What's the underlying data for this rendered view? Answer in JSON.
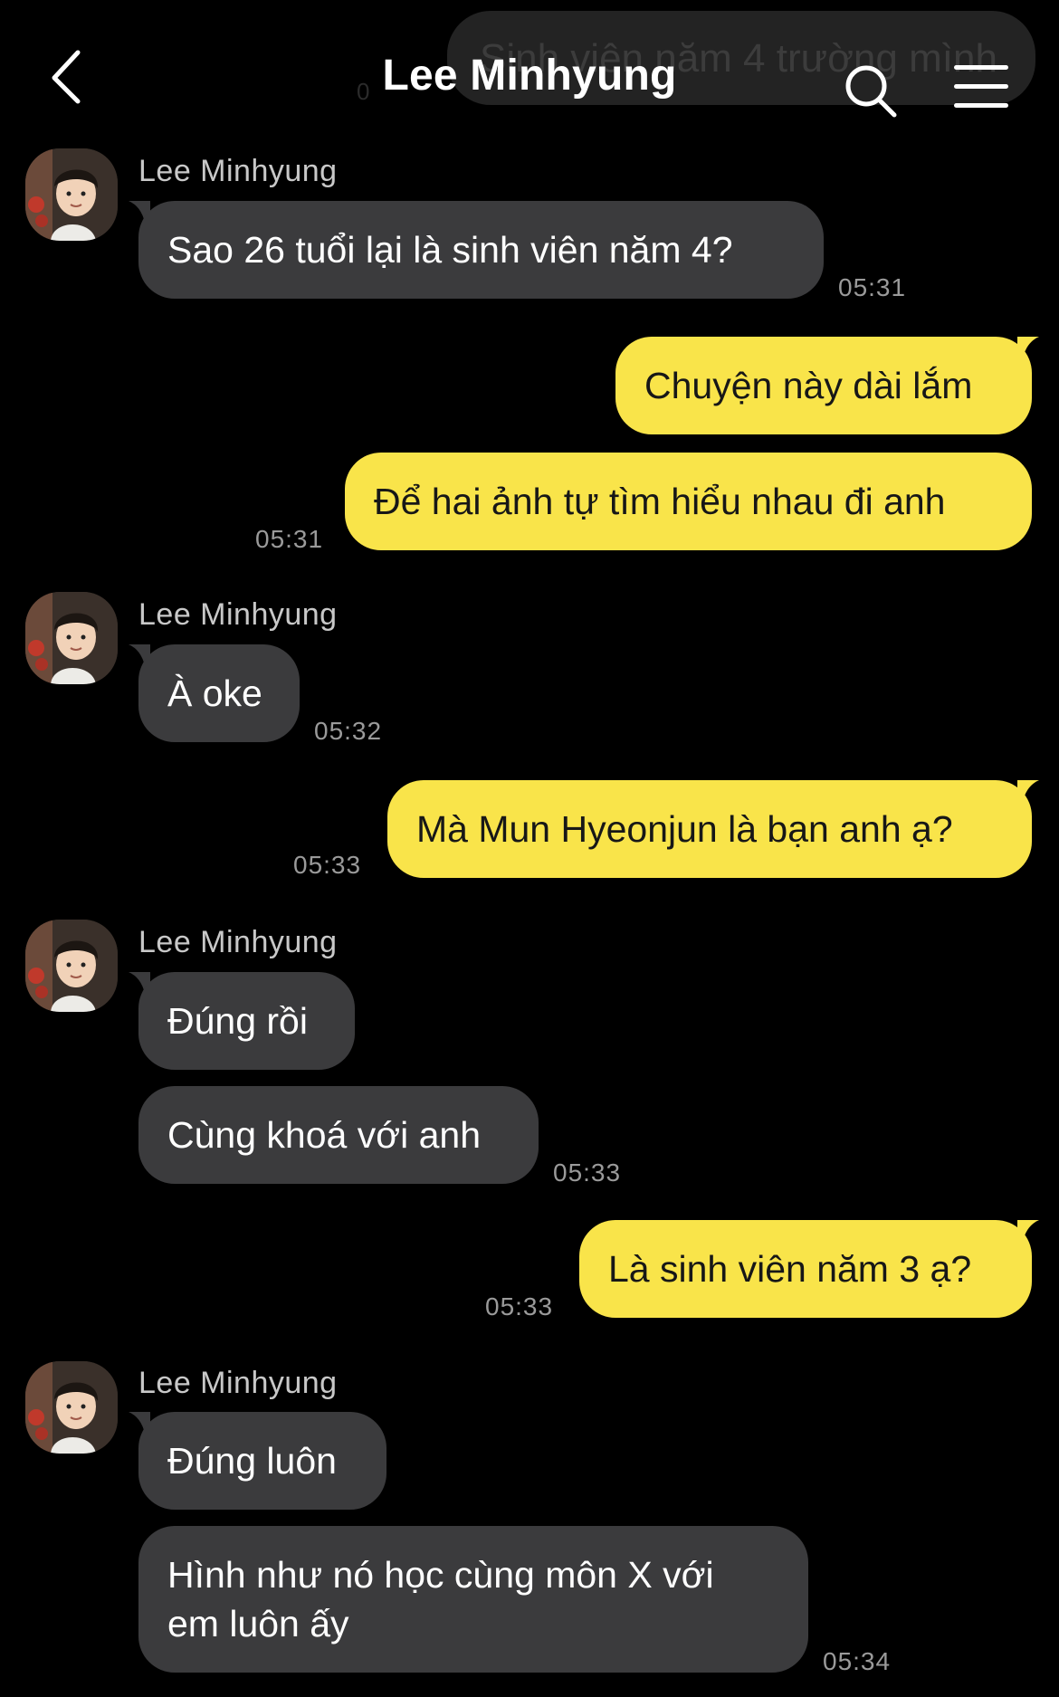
{
  "header": {
    "title": "Lee Minhyung",
    "back_icon": "chevron-left-icon",
    "search_icon": "search-icon",
    "menu_icon": "hamburger-menu-icon",
    "ghost_preview_text": "Sinh viên năm 4 trường mình",
    "ghost_preview_time": "0"
  },
  "colors": {
    "background": "#000000",
    "incoming_bubble": "#3b3b3d",
    "outgoing_bubble": "#f9e44a",
    "timestamp": "#9a9a9a"
  },
  "messages": [
    {
      "direction": "in",
      "sender": "Lee Minhyung",
      "text": "Sao 26 tuổi lại là sinh viên năm 4?",
      "time": "05:31"
    },
    {
      "direction": "out",
      "text": "Chuyện này dài lắm"
    },
    {
      "direction": "out",
      "text": "Để hai ảnh tự tìm hiểu nhau đi anh",
      "time": "05:31"
    },
    {
      "direction": "in",
      "sender": "Lee Minhyung",
      "text": "À oke",
      "time": "05:32"
    },
    {
      "direction": "out",
      "text": "Mà Mun Hyeonjun là bạn anh ạ?",
      "time": "05:33"
    },
    {
      "direction": "in",
      "sender": "Lee Minhyung",
      "text": "Đúng rồi"
    },
    {
      "direction": "in",
      "text": "Cùng khoá với anh",
      "time": "05:33"
    },
    {
      "direction": "out",
      "text": "Là sinh viên năm 3 ạ?",
      "time": "05:33"
    },
    {
      "direction": "in",
      "sender": "Lee Minhyung",
      "text": "Đúng luôn"
    },
    {
      "direction": "in",
      "text_line1": "Hình như nó học cùng môn X với",
      "text_line2": "em luôn ấy",
      "time": "05:34"
    }
  ]
}
